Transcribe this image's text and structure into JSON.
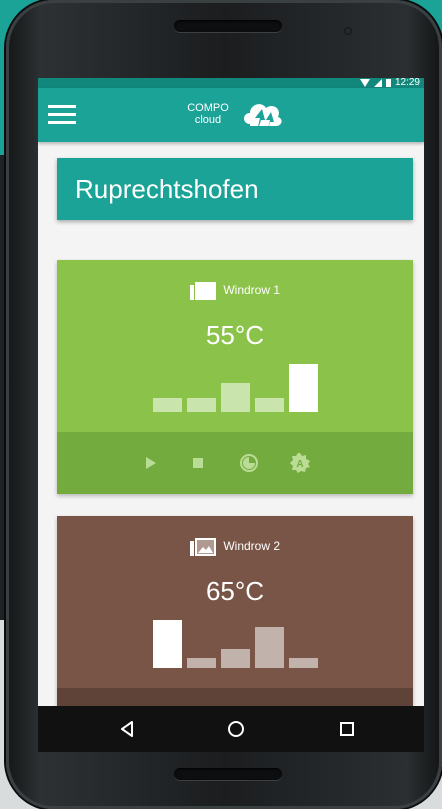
{
  "status_bar": {
    "time": "12:29",
    "icons": [
      "wifi-icon",
      "signal-icon",
      "battery-icon"
    ]
  },
  "app_bar": {
    "menu_icon": "hamburger-menu-icon",
    "logo_line1": "COMPO",
    "logo_line2": "cloud",
    "logo_icon": "cloud-arrows-icon"
  },
  "location": {
    "title": "Ruprechtshofen"
  },
  "windrows": [
    {
      "label": "Windrow 1",
      "temperature": "55°C",
      "color": "#8bc34a",
      "controls_color": "#74ab3e",
      "bar_levels": [
        0.3,
        0.3,
        0.6,
        0.3,
        1.0
      ],
      "bar_highlight": 4,
      "controls": [
        "play-icon",
        "stop-icon",
        "timer-icon",
        "auto-mode-icon"
      ]
    },
    {
      "label": "Windrow 2",
      "temperature": "65°C",
      "color": "#795548",
      "controls_color": "#5f4338",
      "bar_levels": [
        1.0,
        0.2,
        0.4,
        0.85,
        0.2
      ],
      "bar_highlight": 0,
      "controls": []
    }
  ],
  "nav_bar": {
    "buttons": [
      "back-icon",
      "home-icon",
      "recents-icon"
    ]
  }
}
